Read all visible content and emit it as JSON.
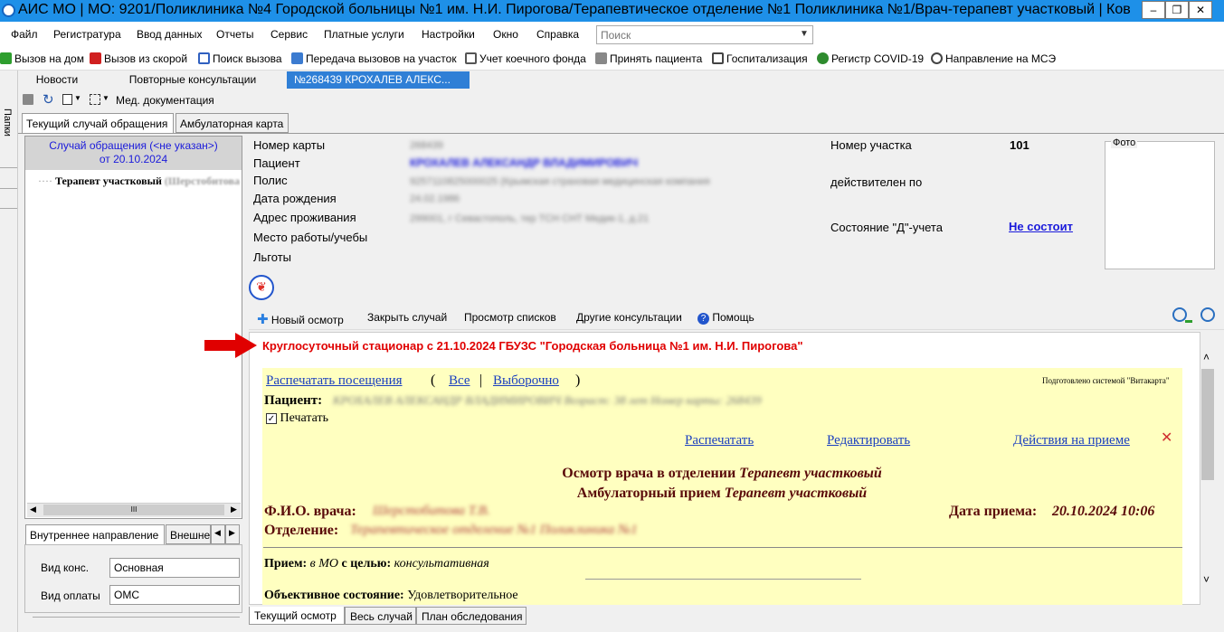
{
  "window": {
    "title": "АИС МО | МО: 9201/Поликлиника №4 Городской больницы №1 им. Н.И. Пирогова/Терапевтическое отделение №1 Поликлиника №1/Врач-терапевт участковый | Ковальская ...",
    "minimize": "–",
    "maximize": "❐",
    "close": "✕"
  },
  "menu": {
    "items": [
      "Файл",
      "Регистратура",
      "Ввод данных",
      "Отчеты",
      "Сервис",
      "Платные услуги",
      "Настройки",
      "Окно",
      "Справка"
    ],
    "search_placeholder": "Поиск"
  },
  "toolbar": {
    "items": [
      {
        "label": "Вызов на дом",
        "icon": "home-call-icon",
        "color": "#2e9e2e"
      },
      {
        "label": "Вызов из скорой",
        "icon": "ambulance-icon",
        "color": "#d02020"
      },
      {
        "label": "Поиск вызова",
        "icon": "search-call-icon",
        "color": "#3060c0"
      },
      {
        "label": "Передача вызовов на участок",
        "icon": "transfer-icon",
        "color": "#3b7bd0"
      },
      {
        "label": "Учет коечного фонда",
        "icon": "bed-fund-icon",
        "color": "#555555"
      },
      {
        "label": "Принять пациента",
        "icon": "accept-patient-icon",
        "color": "#666666"
      },
      {
        "label": "Госпитализация",
        "icon": "hospitalization-icon",
        "color": "#444444"
      },
      {
        "label": "Регистр COVID-19",
        "icon": "covid-icon",
        "color": "#2e8b2e"
      },
      {
        "label": "Направление на МСЭ",
        "icon": "mse-icon",
        "color": "#444444"
      }
    ]
  },
  "doc_tabs": {
    "items": [
      "Новости",
      "Повторные консультации",
      "№268439 КРОХАЛЕВ АЛЕКС..."
    ],
    "close": "✕"
  },
  "left_strip": {
    "label": "Папки"
  },
  "sub_toolbar": {
    "med_docs": "Мед. документация"
  },
  "inner_tabs": {
    "current": "Текущий случай обращения",
    "ambulatory": "Амбулаторная карта"
  },
  "case_panel": {
    "header_line1": "Случай обращения (<не указан>)",
    "header_line2": "от 20.10.2024",
    "tree_item": "Терапевт участковый",
    "tree_item_blurred": "(Шерстобитова",
    "scroll_label": "III"
  },
  "bottom_left": {
    "tabs": [
      "Внутреннее направление",
      "Внешне"
    ],
    "fields": [
      {
        "label": "Вид конс.",
        "value": "Основная"
      },
      {
        "label": "Вид оплаты",
        "value": "ОМС"
      }
    ]
  },
  "patient_info": {
    "labels": [
      "Номер карты",
      "Пациент",
      "Полис",
      "Дата рождения",
      "Адрес проживания",
      "Место работы/учебы",
      "Льготы"
    ],
    "card_number": "268439",
    "patient_name": "КРОХАЛЕВ АЛЕКСАНДР ВЛАДИМИРОВИЧ",
    "policy": "9257110825000025 (Крымская страховая медицинская компания",
    "birth_date": "24.02.1986",
    "address": "299001, г Севастополь, тер ТСН СНТ Медик-1, д.21",
    "district_label": "Номер участка",
    "district_value": "101",
    "valid_until_label": "действителен по",
    "d_status_label": "Состояние \"Д\"-учета",
    "d_status_value": "Не состоит",
    "photo_label": "Фото"
  },
  "content_toolbar": {
    "new_exam": "Новый осмотр",
    "close_case": "Закрыть случай",
    "view_lists": "Просмотр списков",
    "other_consultations": "Другие консультации",
    "help": "Помощь"
  },
  "document": {
    "stationary": "Круглосуточный стационар с 21.10.2024 ГБУЗС \"Городская больница №1 им. Н.И. Пирогова\"",
    "print_visits": "Распечатать посещения",
    "paren_open": "(",
    "all": "Все",
    "separator": "|",
    "selective": "Выборочно",
    "paren_close": ")",
    "prepared_by": "Подготовлено системой \"Витакарта\"",
    "patient_label": "Пациент:",
    "patient_value": "КРОХАЛЕВ АЛЕКСАНДР ВЛАДИМИРОВИЧ Возраст: 38 лет Номер карты: 268439",
    "print_checkbox": "Печатать",
    "print_link": "Распечатать",
    "edit_link": "Редактировать",
    "actions_link": "Действия на приеме",
    "delete": "✕",
    "heading1_prefix": "Осмотр врача в отделении",
    "heading1_italic": "Терапевт участковый",
    "heading2_prefix": "Амбулаторный прием",
    "heading2_italic": "Терапевт участковый",
    "doctor_label": "Ф.И.О. врача:",
    "doctor_value": "Шерстобитова Т.В.",
    "dept_label": "Отделение:",
    "dept_value": "Терапевтическое отделение №1 Поликлиника №1",
    "date_label": "Дата приема:",
    "date_value": "20.10.2024 10:06",
    "reception_label": "Прием:",
    "reception_place": "в МО",
    "reception_goal_label": "с целью:",
    "reception_goal": "консультативная",
    "objective_label": "Объективное состояние:",
    "objective_value": "Удовлетворительное"
  },
  "bottom_tabs": [
    "Текущий осмотр",
    "Весь случай",
    "План обследования"
  ],
  "colors": {
    "titlebar": "#1e90e8",
    "active_tab": "#2f7fd6",
    "doc_yellow": "#ffffc0",
    "alert_red": "#e00000",
    "link_blue": "#1a3fbf"
  }
}
